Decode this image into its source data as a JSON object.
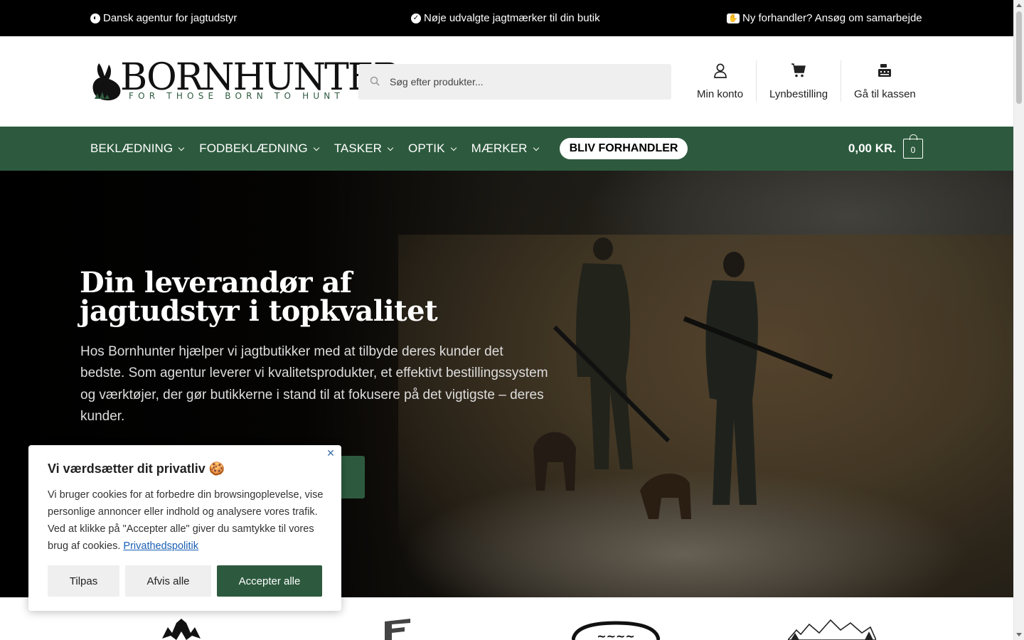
{
  "topbar": {
    "item1": "Dansk agentur for jagtudstyr",
    "item2": "Nøje udvalgte jagtmærker til din butik",
    "item3": "Ny forhandler? Ansøg om samarbejde"
  },
  "header": {
    "logo_text": "BORNHUNTER",
    "logo_tagline": "FOR THOSE BORN TO HUNT",
    "search_placeholder": "Søg efter produkter...",
    "links": {
      "account": "Min konto",
      "quick_order": "Lynbestilling",
      "checkout": "Gå til kassen"
    }
  },
  "nav": {
    "items": [
      "BEKLÆDNING",
      "FODBEKLÆDNING",
      "TASKER",
      "OPTIK",
      "MÆRKER"
    ],
    "cta": "BLIV FORHANDLER",
    "cart_amount": "0,00 KR.",
    "cart_count": "0"
  },
  "hero": {
    "title_line1": "Din leverandør af",
    "title_line2": "jagtudstyr i topkvalitet",
    "body": "Hos Bornhunter hjælper vi jagtbutikker med at tilbyde deres kunder det bedste. Som agentur leverer vi kvalitetsprodukter, et effektivt bestillingssystem og værktøjer, der gør butikkerne i stand til at fokusere på det vigtigste – deres kunder."
  },
  "cookie": {
    "title": "Vi værdsætter dit privatliv 🍪",
    "text": "Vi bruger cookies for at forbedre din browsingoplevelse, vise personlige annoncer eller indhold og analysere vores trafik. Ved at klikke på \"Accepter alle\" giver du samtykke til vores brug af cookies.",
    "link": "Privathedspolitik",
    "btn_customize": "Tilpas",
    "btn_reject": "Afvis alle",
    "btn_accept": "Accepter alle"
  },
  "colors": {
    "brand_green": "#2d5a3e",
    "topbar_bg": "#000000"
  },
  "icons": {
    "account": "user-icon",
    "quick_order": "cart-icon",
    "checkout": "register-icon",
    "search": "search-icon"
  }
}
